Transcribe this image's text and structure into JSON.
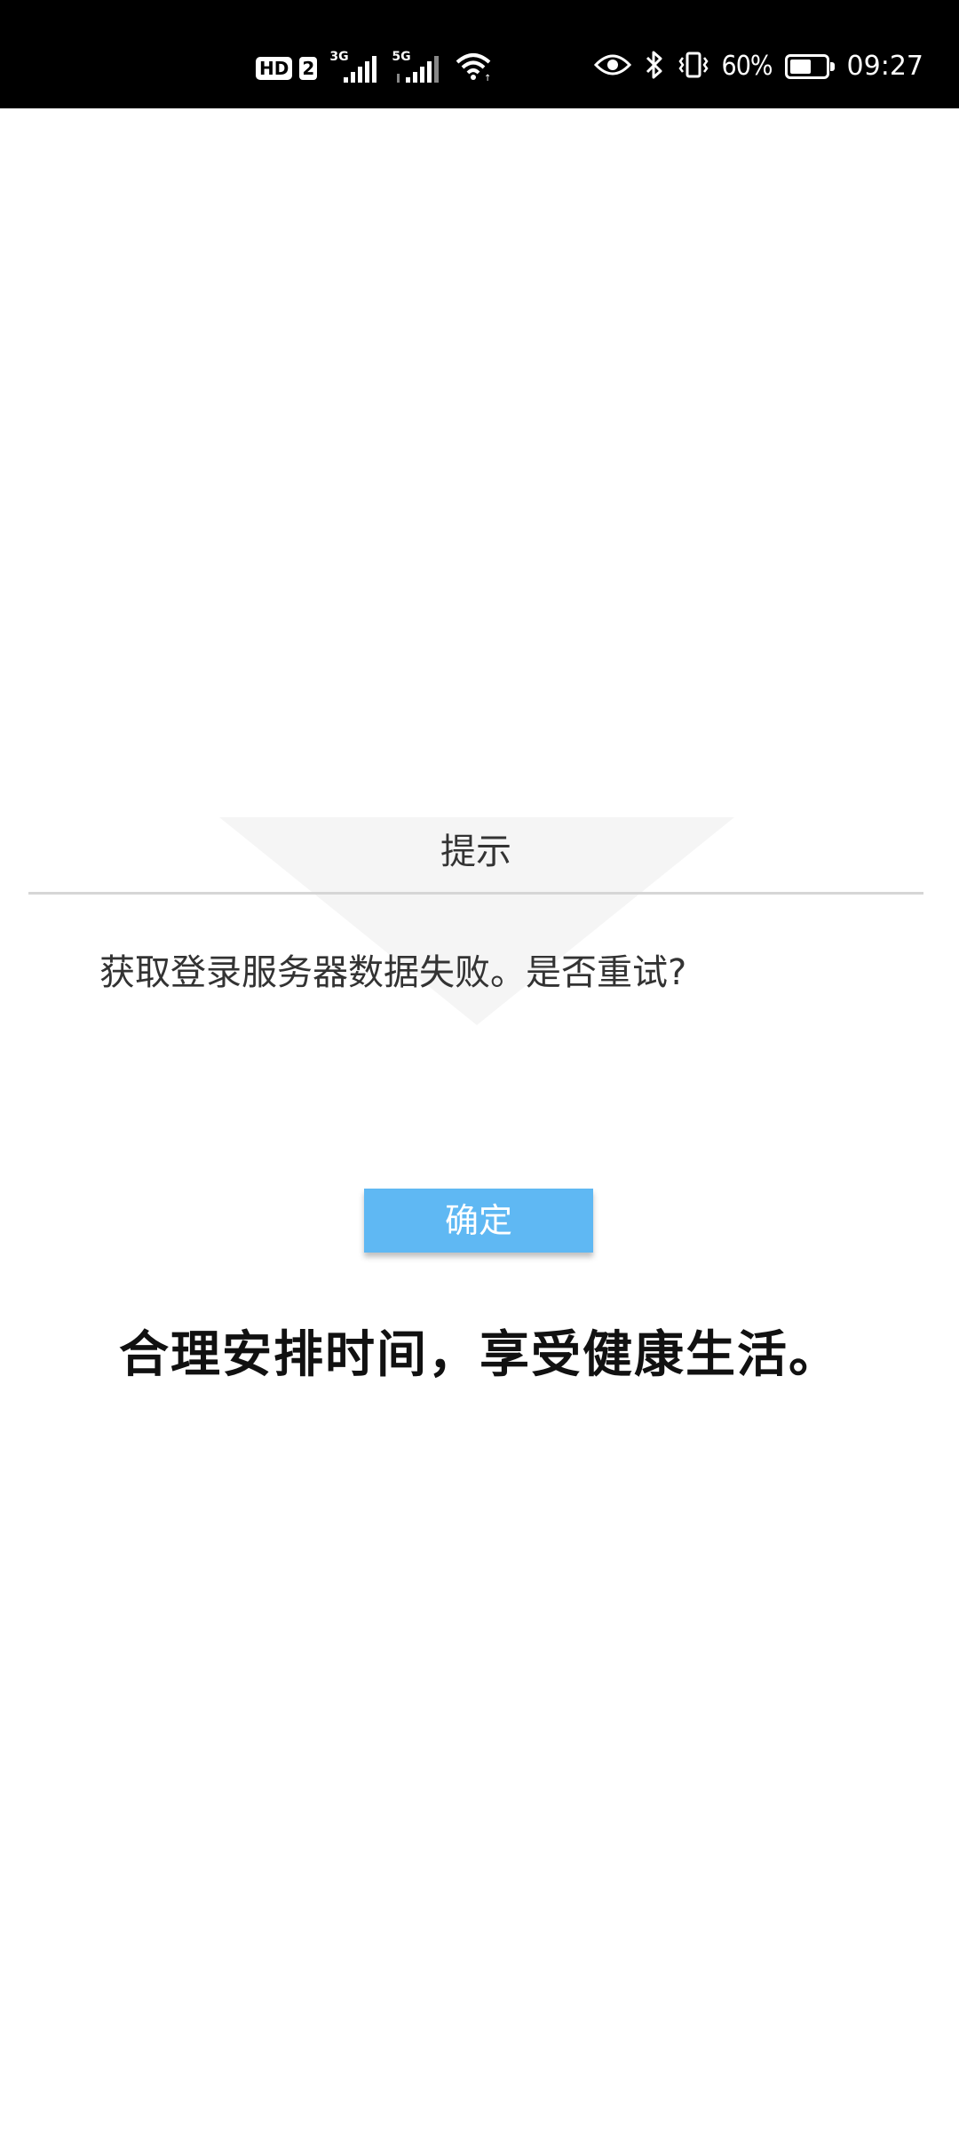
{
  "status_bar": {
    "hd_label": "HD",
    "sim_label": "2",
    "signal1_tag": "3G",
    "signal2_tag": "5G",
    "battery_percent_text": "60%",
    "battery_level": 0.6,
    "time": "09:27",
    "icons": [
      "hd-icon",
      "signal-3g-icon",
      "signal-5g-icon",
      "wifi-icon",
      "eye-comfort-icon",
      "bluetooth-icon",
      "vibrate-icon",
      "battery-icon"
    ]
  },
  "dialog": {
    "title": "提示",
    "message": "获取登录服务器数据失败。是否重试?"
  },
  "confirm_button": {
    "label": "确定",
    "color": "#5fb8f3"
  },
  "slogan": "合理安排时间，享受健康生活。"
}
